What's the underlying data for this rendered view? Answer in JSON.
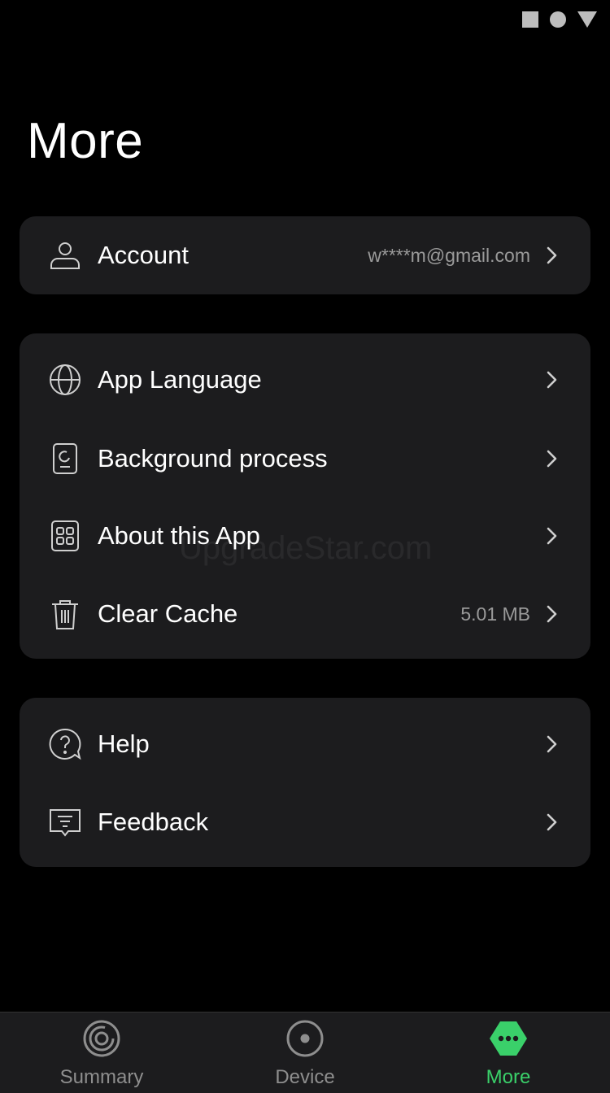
{
  "page": {
    "title": "More"
  },
  "account": {
    "label": "Account",
    "value": "w****m@gmail.com",
    "icon": "user-icon"
  },
  "settings": {
    "items": [
      {
        "label": "App Language",
        "icon": "globe-icon"
      },
      {
        "label": "Background process",
        "icon": "phone-process-icon"
      },
      {
        "label": "About this App",
        "icon": "grid-apps-icon"
      },
      {
        "label": "Clear Cache",
        "icon": "trash-icon",
        "value": "5.01 MB"
      }
    ]
  },
  "support": {
    "items": [
      {
        "label": "Help",
        "icon": "help-bubble-icon"
      },
      {
        "label": "Feedback",
        "icon": "feedback-icon"
      }
    ]
  },
  "watermark": "UpgradeStar.com",
  "tabs": [
    {
      "label": "Summary",
      "icon": "summary-rings-icon",
      "active": false
    },
    {
      "label": "Device",
      "icon": "device-dial-icon",
      "active": false
    },
    {
      "label": "More",
      "icon": "more-dots-icon",
      "active": true
    }
  ],
  "colors": {
    "accent": "#3ad06a",
    "card": "#1c1c1e",
    "background": "#000000",
    "muted": "#9a9a9a"
  }
}
